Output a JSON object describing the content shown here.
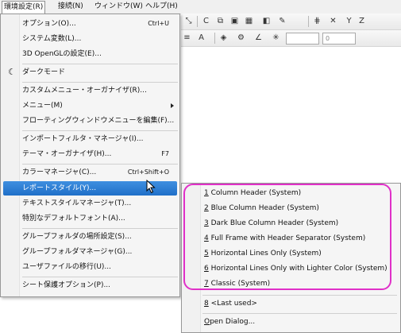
{
  "menubar": {
    "items": [
      {
        "label": "環境設定(R)",
        "active": true
      },
      {
        "label": "接続(N)"
      },
      {
        "label": "ウィンドウ(W)"
      },
      {
        "label": "ヘルプ(H)"
      }
    ]
  },
  "toolbar": {
    "row2_combo_value": "0"
  },
  "dropdown": {
    "items": [
      {
        "label": "オプション(O)...",
        "shortcut": "Ctrl+U"
      },
      {
        "label": "システム変数(L)..."
      },
      {
        "label": "3D OpenGLの設定(E)..."
      },
      {
        "label": "ダークモード",
        "icon": "moon-icon"
      },
      {
        "label": "カスタムメニュー・オーガナイザ(R)..."
      },
      {
        "label": "メニュー(M)",
        "submenu": true
      },
      {
        "label": "フローティングウィンドウメニューを編集(F)..."
      },
      {
        "label": "インポートフィルタ・マネージャ(I)..."
      },
      {
        "label": "テーマ・オーガナイザ(H)...",
        "shortcut": "F7"
      },
      {
        "label": "カラーマネージャ(C)...",
        "shortcut": "Ctrl+Shift+O"
      },
      {
        "label": "レポートスタイル(Y)...",
        "submenu": true,
        "highlight": true
      },
      {
        "label": "テキストスタイルマネージャ(T)..."
      },
      {
        "label": "特別なデフォルトフォント(A)..."
      },
      {
        "label": "グループフォルダの場所設定(S)..."
      },
      {
        "label": "グループフォルダマネージャ(G)..."
      },
      {
        "label": "ユーザファイルの移行(U)..."
      },
      {
        "label": "シート保護オプション(P)..."
      }
    ]
  },
  "submenu": {
    "items": [
      {
        "num": "1",
        "label": "Column Header (System)"
      },
      {
        "num": "2",
        "label": "Blue Column Header (System)"
      },
      {
        "num": "3",
        "label": "Dark Blue Column Header (System)"
      },
      {
        "num": "4",
        "label": "Full Frame with Header Separator (System)"
      },
      {
        "num": "5",
        "label": "Horizontal Lines Only (System)"
      },
      {
        "num": "6",
        "label": "Horizontal Lines Only with Lighter Color (System)"
      },
      {
        "num": "7",
        "label": "Classic (System)"
      },
      {
        "num": "8",
        "label": "<Last used>"
      },
      {
        "num": "O",
        "label": "pen Dialog..."
      }
    ]
  },
  "colors": {
    "highlight_start": "#3f8fe0",
    "highlight_end": "#1f6fc8",
    "annotation_border": "#e030c8"
  }
}
